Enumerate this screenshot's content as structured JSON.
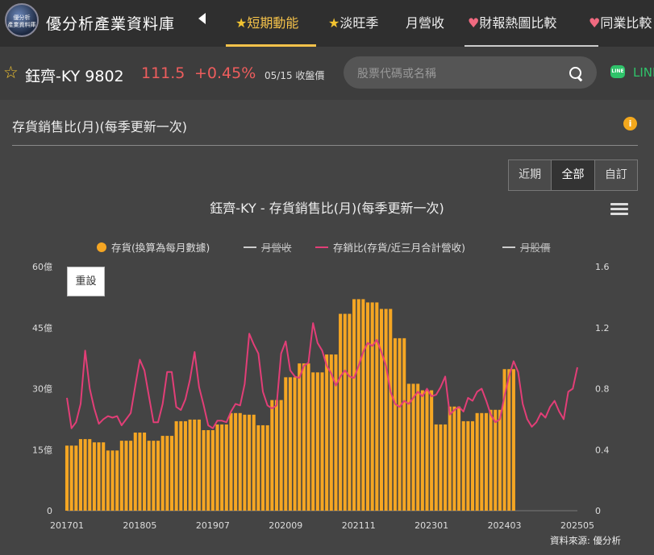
{
  "header": {
    "logo_text": "優分析\n產業資料庫",
    "brand": "優分析產業資料庫",
    "nav": [
      {
        "label": "短期動能",
        "icon": "star-icon",
        "glyph": "★",
        "active": true
      },
      {
        "label": "淡旺季",
        "icon": "star-icon",
        "glyph": "★",
        "active": false
      },
      {
        "label": "月營收",
        "icon": "",
        "glyph": "",
        "active": false
      },
      {
        "label": "財報熱圖比較",
        "icon": "heart-icon",
        "glyph": "♥",
        "active": false
      },
      {
        "label": "同業比較",
        "icon": "heart-icon",
        "glyph": "♥",
        "active": false
      }
    ]
  },
  "stock": {
    "name": "鈺齊-KY 9802",
    "price": "111.5",
    "change": "+0.45%",
    "date": "05/15 收盤價"
  },
  "search": {
    "placeholder": "股票代碼或名稱"
  },
  "line_share": {
    "label": "LINE"
  },
  "panel": {
    "title": "存貨銷售比(月)(每季更新一次)"
  },
  "range_buttons": [
    "近期",
    "全部",
    "自訂"
  ],
  "range_active": "全部",
  "reset_label": "重設",
  "source": "資料來源: 優分析",
  "colors": {
    "bar": "#f5a623",
    "line": "#e23e77",
    "background": "#444444",
    "accent": "#f5c24a"
  },
  "chart_data": {
    "type": "bar+line",
    "title": "鈺齊-KY - 存貨銷售比(月)(每季更新一次)",
    "legend": [
      {
        "name": "存貨(換算為每月數據)",
        "kind": "bar",
        "visible": true
      },
      {
        "name": "月營收",
        "kind": "line",
        "visible": false
      },
      {
        "name": "存銷比(存貨/近三月合計營收)",
        "kind": "line",
        "visible": true
      },
      {
        "name": "月股價",
        "kind": "line",
        "visible": false
      }
    ],
    "legend_position": "top",
    "grid": "none",
    "x_tick_labels": [
      "201701",
      "201805",
      "201907",
      "202009",
      "202111",
      "202301",
      "202403",
      "202505"
    ],
    "x_range": [
      "2017-01",
      "2025-05"
    ],
    "y_left": {
      "ticks": [
        "0",
        "15億",
        "30億",
        "45億",
        "60億"
      ],
      "range": [
        0,
        60
      ],
      "unit": "億"
    },
    "y_right": {
      "ticks": [
        "0",
        "0.4",
        "0.8",
        "1.2",
        "1.6"
      ],
      "range": [
        0,
        1.6
      ]
    },
    "series": [
      {
        "name": "存貨(換算為每月數據)",
        "type": "bar",
        "axis": "left",
        "note": "quarterly values, one per quarter starting 2017Q1",
        "values": [
          16.0,
          17.6,
          16.8,
          14.8,
          17.2,
          19.2,
          17.2,
          18.4,
          22.0,
          22.4,
          19.8,
          21.2,
          24.0,
          23.6,
          21.0,
          27.2,
          32.8,
          36.2,
          34.0,
          38.4,
          48.4,
          52.0,
          51.2,
          49.6,
          42.4,
          31.2,
          29.6,
          21.2,
          25.6,
          22.0,
          24.0,
          24.8,
          34.8
        ]
      },
      {
        "name": "存銷比(存貨/近三月合計營收)",
        "type": "line",
        "axis": "right",
        "note": "monthly values from 2017-01 to 2025-05",
        "values": [
          0.74,
          0.54,
          0.58,
          0.7,
          1.05,
          0.8,
          0.67,
          0.57,
          0.6,
          0.62,
          0.61,
          0.62,
          0.56,
          0.6,
          0.64,
          0.82,
          0.99,
          0.92,
          0.75,
          0.58,
          0.58,
          0.7,
          0.91,
          0.91,
          0.68,
          0.66,
          0.73,
          0.86,
          1.04,
          0.81,
          0.69,
          0.56,
          0.54,
          0.59,
          0.59,
          0.58,
          0.65,
          0.7,
          0.69,
          0.83,
          1.16,
          1.09,
          1.03,
          0.78,
          0.69,
          0.67,
          0.69,
          1.03,
          1.11,
          0.92,
          0.88,
          0.87,
          0.95,
          0.97,
          1.23,
          1.1,
          1.05,
          0.95,
          0.9,
          0.82,
          0.88,
          0.92,
          0.88,
          0.87,
          0.95,
          1.04,
          1.1,
          1.08,
          1.12,
          1.04,
          0.95,
          0.78,
          0.7,
          0.68,
          0.72,
          0.7,
          0.74,
          0.78,
          0.75,
          0.8,
          0.75,
          0.76,
          0.81,
          0.88,
          0.63,
          0.66,
          0.68,
          0.65,
          0.74,
          0.72,
          0.78,
          0.8,
          0.72,
          0.63,
          0.58,
          0.6,
          0.75,
          0.88,
          0.98,
          0.91,
          0.7,
          0.6,
          0.55,
          0.58,
          0.64,
          0.61,
          0.68,
          0.72,
          0.65,
          0.6,
          0.78,
          0.8,
          0.94
        ]
      }
    ]
  }
}
